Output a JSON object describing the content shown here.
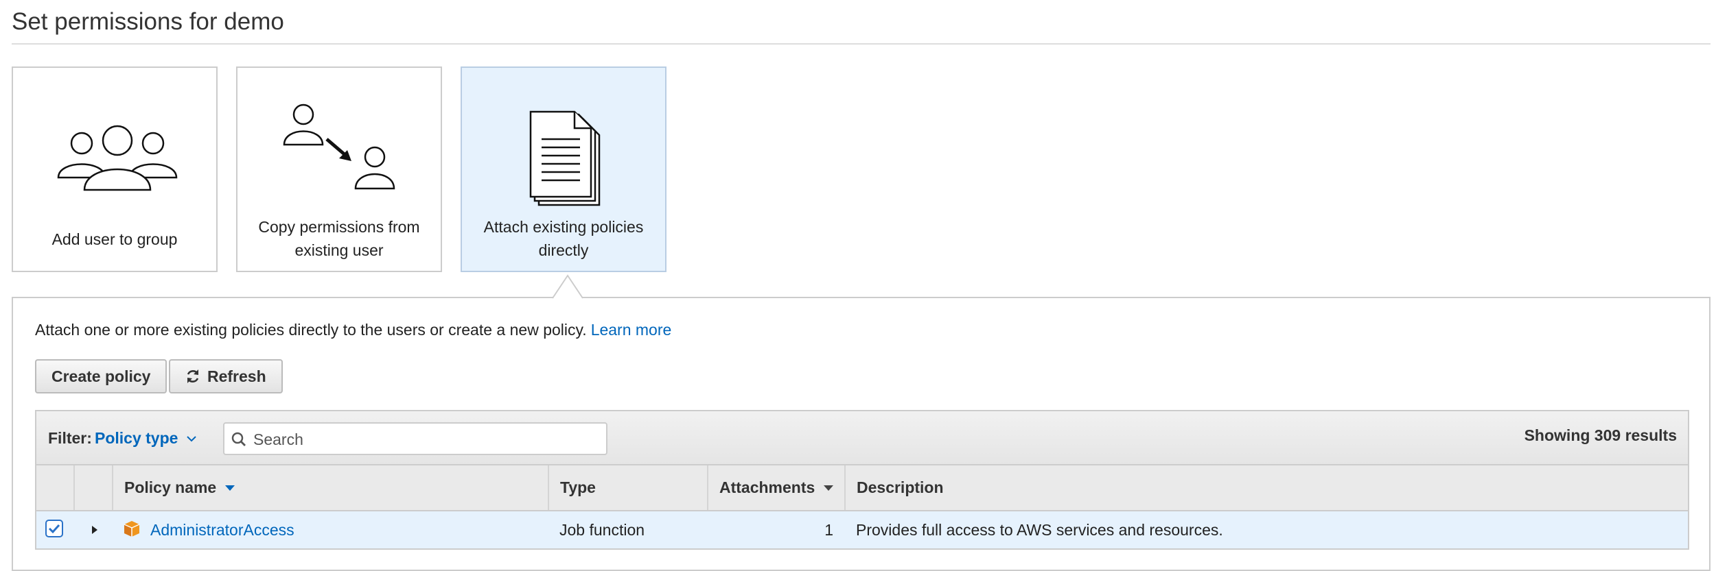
{
  "page": {
    "title": "Set permissions for demo"
  },
  "options": [
    {
      "label_line1": "Add user to group",
      "label_line2": "",
      "selected": false
    },
    {
      "label_line1": "Copy permissions from",
      "label_line2": "existing user",
      "selected": false
    },
    {
      "label_line1": "Attach existing policies",
      "label_line2": "directly",
      "selected": true
    }
  ],
  "panel": {
    "intro_text": "Attach one or more existing policies directly to the users or create a new policy.",
    "learn_more": "Learn more"
  },
  "buttons": {
    "create_policy": "Create policy",
    "refresh": "Refresh"
  },
  "filter": {
    "label": "Filter:",
    "selected": "Policy type",
    "search_placeholder": "Search",
    "search_value": "",
    "results": "Showing 309 results"
  },
  "table": {
    "columns": [
      "Policy name",
      "Type",
      "Attachments",
      "Description"
    ],
    "sorted_columns": [
      "Policy name",
      "Attachments"
    ],
    "rows": [
      {
        "checked": true,
        "expanded": false,
        "icon": "policy-box-icon",
        "name": "AdministratorAccess",
        "type": "Job function",
        "attachments": "1",
        "description": "Provides full access to AWS services and resources."
      }
    ]
  },
  "colors": {
    "accent_link": "#0066bb",
    "selected_bg": "#e6f2fd",
    "policy_icon": "#f0961e",
    "border": "#cccccc"
  }
}
